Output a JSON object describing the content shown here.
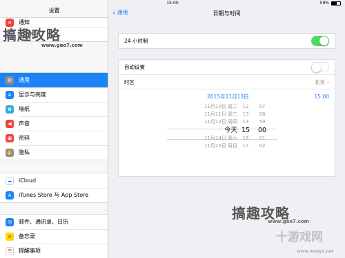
{
  "status": {
    "device": "iPad",
    "time": "15:00",
    "battery": "59%",
    "battery_level": 0.59
  },
  "sidebar": {
    "title": "设置",
    "top_items": [
      {
        "label": "通知",
        "icon": "notification-icon",
        "color": "#f2413a"
      },
      {
        "label": "勿扰模式",
        "icon": "moon-icon",
        "color": "#5a5ad6"
      }
    ],
    "general_items": [
      {
        "label": "通用",
        "icon": "gear-icon",
        "color": "#8e8e93"
      },
      {
        "label": "显示与亮度",
        "icon": "text-size-icon",
        "color": "#1b84f6"
      },
      {
        "label": "墙纸",
        "icon": "flower-icon",
        "color": "#34aadc"
      },
      {
        "label": "声音",
        "icon": "speaker-icon",
        "color": "#f2413a"
      },
      {
        "label": "密码",
        "icon": "lock-icon",
        "color": "#f2413a"
      },
      {
        "label": "隐私",
        "icon": "hand-icon",
        "color": "#8e8e93"
      }
    ],
    "store_items": [
      {
        "label": "iCloud",
        "icon": "cloud-icon",
        "color": "#ffffff"
      },
      {
        "label": "iTunes Store 与 App Store",
        "icon": "app-store-icon",
        "color": "#1b84f6"
      }
    ],
    "apps_items": [
      {
        "label": "邮件、通讯录、日历",
        "icon": "mail-icon",
        "color": "#1b84f6"
      },
      {
        "label": "备忘录",
        "icon": "notes-icon",
        "color": "#ffd60a"
      },
      {
        "label": "提醒事项",
        "icon": "reminders-icon",
        "color": "#ffffff"
      }
    ]
  },
  "detail": {
    "back_label": "通用",
    "title": "日期与时间",
    "clock_24h": {
      "label": "24 小时制",
      "on": true
    },
    "auto_set": {
      "label": "自动设置",
      "on": false
    },
    "timezone": {
      "label": "时区",
      "value": "北京"
    },
    "selected_date": "2015年11月13日",
    "selected_time": "15:00",
    "picker": {
      "days": [
        "11月10日 周二",
        "11月11日 周三",
        "11月12日 周四",
        "今天",
        "11月14日 周六",
        "11月15日 周日"
      ],
      "hours": [
        "12",
        "13",
        "14",
        "15",
        "16",
        "17"
      ],
      "minutes": [
        "57",
        "58",
        "59",
        "00",
        "01",
        "02"
      ],
      "selected_index": 3
    }
  },
  "watermarks": {
    "brand": "搞趣攻略",
    "url": "www.gao7.com",
    "site_logo": "十游戏网",
    "site_url": "www.newyx.net"
  },
  "colors": {
    "accent": "#1b84f6",
    "toggle_on": "#4cd964",
    "background": "#efeff4"
  }
}
